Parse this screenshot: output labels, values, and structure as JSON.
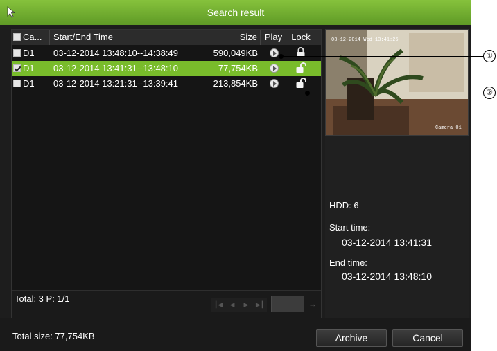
{
  "window": {
    "title": "Search result"
  },
  "table": {
    "headers": {
      "cam": "Ca...",
      "time": "Start/End Time",
      "size": "Size",
      "play": "Play",
      "lock": "Lock"
    },
    "rows": [
      {
        "cam": "D1",
        "time": "03-12-2014 13:48:10--14:38:49",
        "size": "590,049KB",
        "checked": false,
        "selected": false,
        "lock": "locked"
      },
      {
        "cam": "D1",
        "time": "03-12-2014 13:41:31--13:48:10",
        "size": "77,754KB",
        "checked": true,
        "selected": true,
        "lock": "unlocked"
      },
      {
        "cam": "D1",
        "time": "03-12-2014 13:21:31--13:39:41",
        "size": "213,854KB",
        "checked": false,
        "selected": false,
        "lock": "unlocked"
      }
    ]
  },
  "pager": {
    "total": "Total: 3  P: 1/1"
  },
  "preview": {
    "timestamp": "03-12-2014 Wed 13:41:26",
    "camera_label": "Camera 01"
  },
  "info": {
    "hdd": "HDD: 6",
    "start_label": "Start time:",
    "start_value": "03-12-2014 13:41:31",
    "end_label": "End time:",
    "end_value": "03-12-2014 13:48:10"
  },
  "footer": {
    "total_size": "Total size: 77,754KB",
    "archive_label": "Archive",
    "cancel_label": "Cancel"
  },
  "callouts": [
    "①",
    "②"
  ],
  "icons": [
    "cursor-icon",
    "play-icon",
    "lock-icon",
    "unlock-icon",
    "first-page-icon",
    "prev-page-icon",
    "next-page-icon",
    "last-page-icon",
    "go-icon"
  ],
  "colors": {
    "title_bar": "#6fad2e",
    "selected_row": "#79bc2b",
    "background": "#1d1d1d"
  }
}
